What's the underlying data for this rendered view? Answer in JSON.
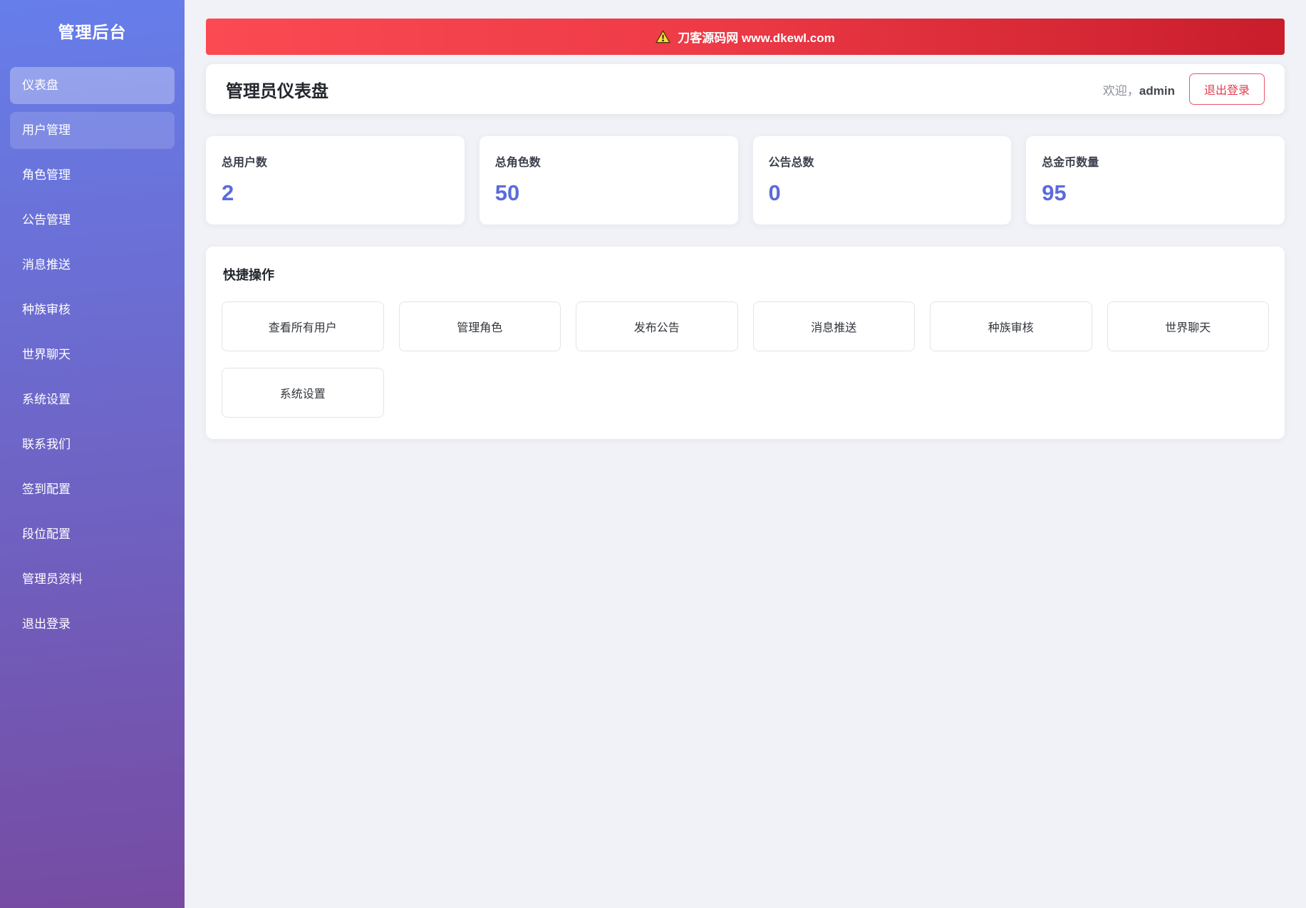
{
  "sidebar": {
    "title": "管理后台",
    "items": [
      {
        "label": "仪表盘",
        "state": "active"
      },
      {
        "label": "用户管理",
        "state": "hovered"
      },
      {
        "label": "角色管理",
        "state": "normal"
      },
      {
        "label": "公告管理",
        "state": "normal"
      },
      {
        "label": "消息推送",
        "state": "normal"
      },
      {
        "label": "种族审核",
        "state": "normal"
      },
      {
        "label": "世界聊天",
        "state": "normal"
      },
      {
        "label": "系统设置",
        "state": "normal"
      },
      {
        "label": "联系我们",
        "state": "normal"
      },
      {
        "label": "签到配置",
        "state": "normal"
      },
      {
        "label": "段位配置",
        "state": "normal"
      },
      {
        "label": "管理员资料",
        "state": "normal"
      },
      {
        "label": "退出登录",
        "state": "normal"
      }
    ]
  },
  "banner": {
    "icon": "warning-icon",
    "text": "刀客源码网 www.dkewl.com"
  },
  "header": {
    "title": "管理员仪表盘",
    "welcome_prefix": "欢迎，",
    "username": "admin",
    "logout_label": "退出登录"
  },
  "stats": [
    {
      "label": "总用户数",
      "value": "2"
    },
    {
      "label": "总角色数",
      "value": "50"
    },
    {
      "label": "公告总数",
      "value": "0"
    },
    {
      "label": "总金币数量",
      "value": "95"
    }
  ],
  "quick_actions": {
    "title": "快捷操作",
    "buttons": [
      {
        "label": "查看所有用户"
      },
      {
        "label": "管理角色"
      },
      {
        "label": "发布公告"
      },
      {
        "label": "消息推送"
      },
      {
        "label": "种族审核"
      },
      {
        "label": "世界聊天"
      },
      {
        "label": "系统设置"
      }
    ]
  },
  "colors": {
    "sidebar_gradient_top": "#667eea",
    "sidebar_gradient_bottom": "#764ba2",
    "banner_red_left": "#fb4a52",
    "banner_red_right": "#c91d2c",
    "stat_value_accent": "#5a6bdc",
    "logout_red": "#e23c50",
    "page_background": "#f1f2f7"
  }
}
